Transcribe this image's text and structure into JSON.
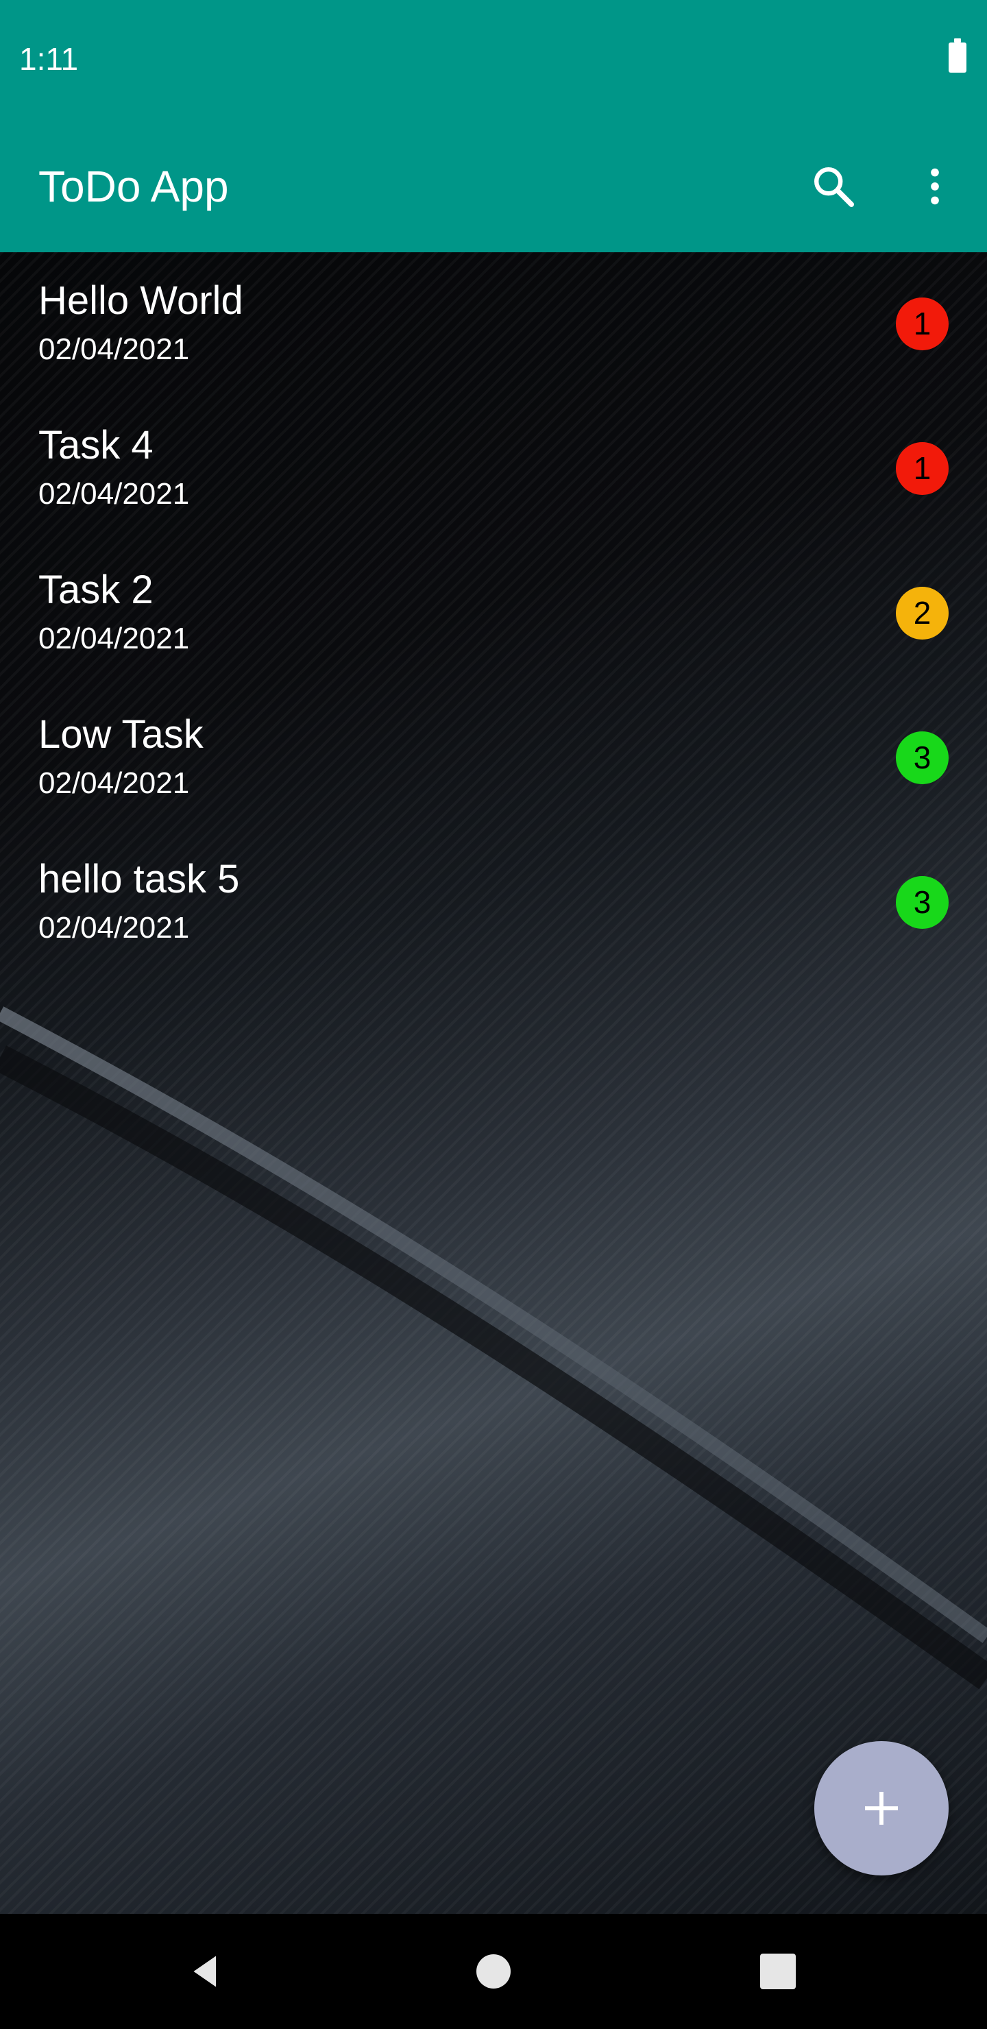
{
  "status_bar": {
    "time": "1:11",
    "battery_icon": "battery-full-icon"
  },
  "app_bar": {
    "title": "ToDo App",
    "search_icon": "search-icon",
    "more_icon": "more-vert-icon",
    "background_color": "#009688"
  },
  "tasks": [
    {
      "title": "Hello World",
      "date": "02/04/2021",
      "priority": "1",
      "priority_color": "#f21a0a"
    },
    {
      "title": "Task 4",
      "date": "02/04/2021",
      "priority": "1",
      "priority_color": "#f21a0a"
    },
    {
      "title": "Task 2",
      "date": "02/04/2021",
      "priority": "2",
      "priority_color": "#f5b30b"
    },
    {
      "title": "Low Task",
      "date": "02/04/2021",
      "priority": "3",
      "priority_color": "#18d81a"
    },
    {
      "title": "hello task 5",
      "date": "02/04/2021",
      "priority": "3",
      "priority_color": "#18d81a"
    }
  ],
  "fab": {
    "icon": "plus-icon",
    "color": "#a9aecb"
  },
  "nav_bar": {
    "back_icon": "back-triangle-icon",
    "home_icon": "home-circle-icon",
    "recents_icon": "recents-square-icon"
  }
}
